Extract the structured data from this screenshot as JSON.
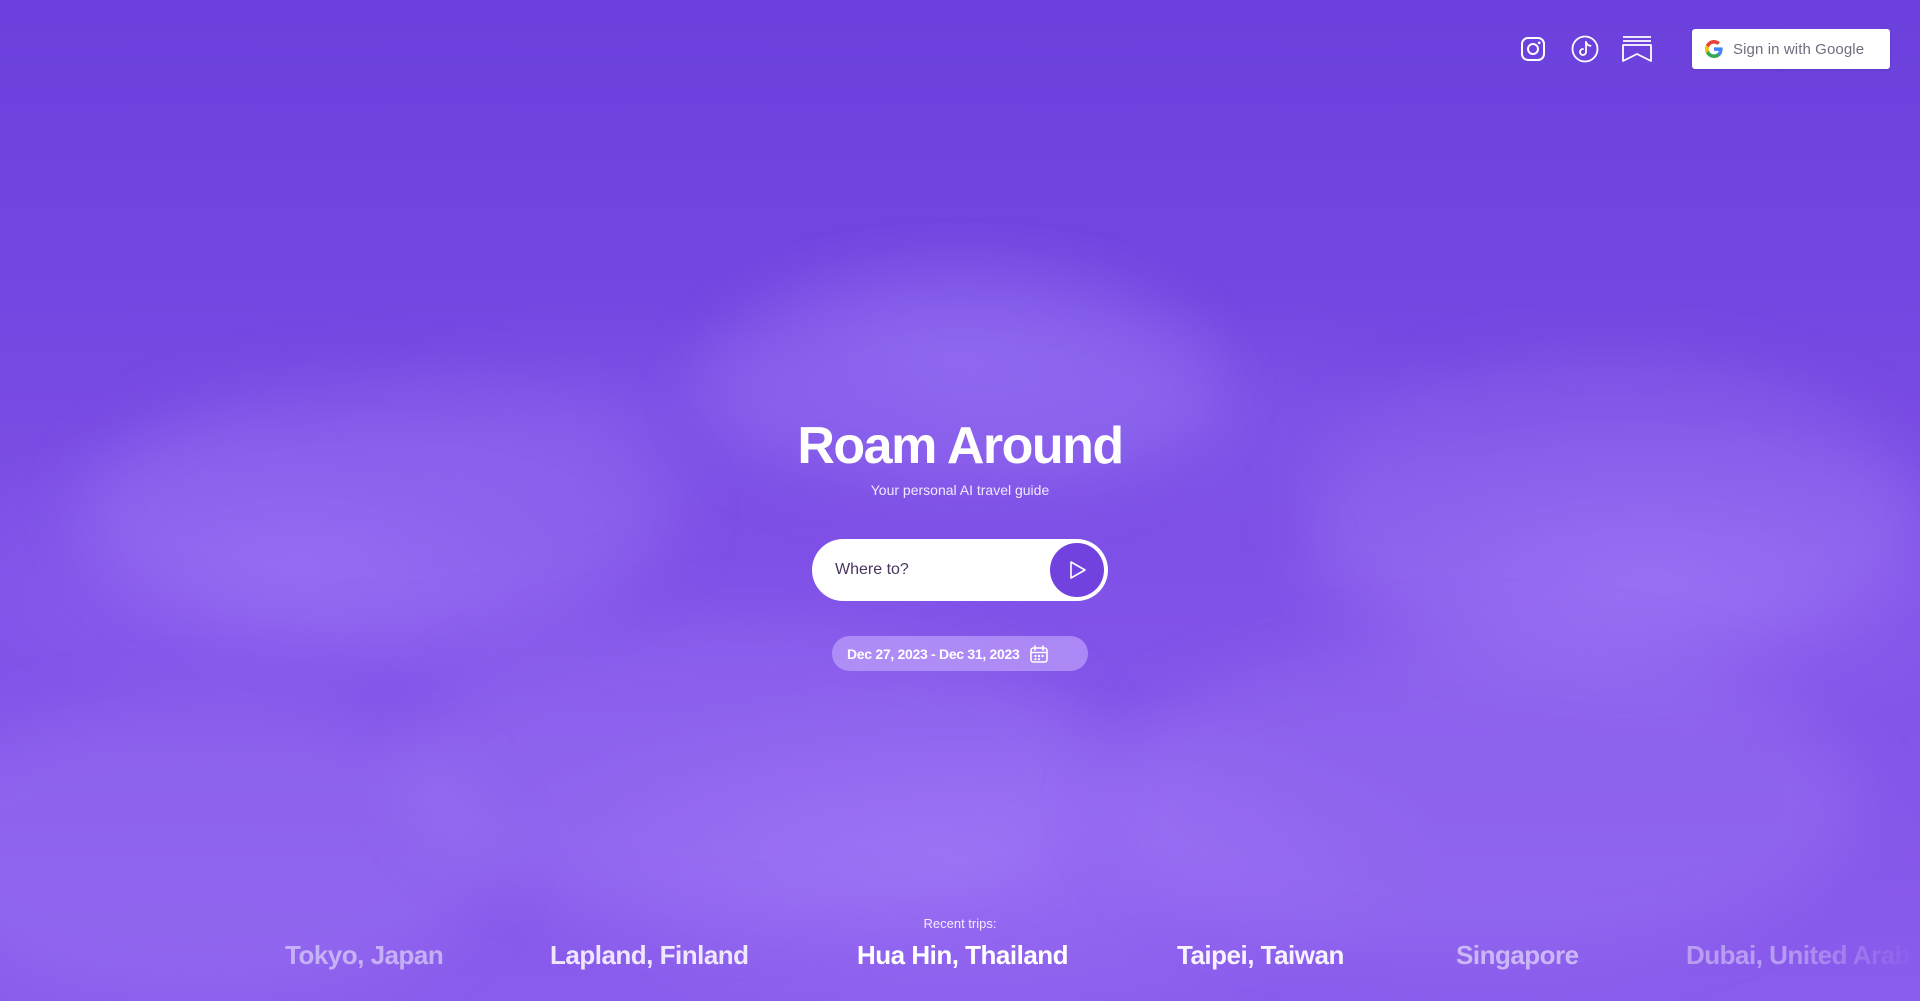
{
  "colors": {
    "brand_purple": "#7242df",
    "background_top": "#6b40dc",
    "background_bottom": "#8a5cec",
    "text": "#ffffff"
  },
  "header": {
    "social_icons": [
      "instagram-icon",
      "tiktok-icon",
      "bookmark-icon"
    ],
    "sign_in_label": "Sign in with Google"
  },
  "hero": {
    "title": "Roam Around",
    "subtitle": "Your personal AI travel guide"
  },
  "search": {
    "placeholder": "Where to?",
    "submit_icon": "play-arrow-icon"
  },
  "dates": {
    "label": "Dec 27, 2023 - Dec 31, 2023",
    "icon": "calendar-icon"
  },
  "recent": {
    "label": "Recent trips:",
    "trips": [
      "Tokyo, Japan",
      "Lapland, Finland",
      "Hua Hin, Thailand",
      "Taipei, Taiwan",
      "Singapore",
      "Dubai, United Arab Emirates"
    ]
  }
}
